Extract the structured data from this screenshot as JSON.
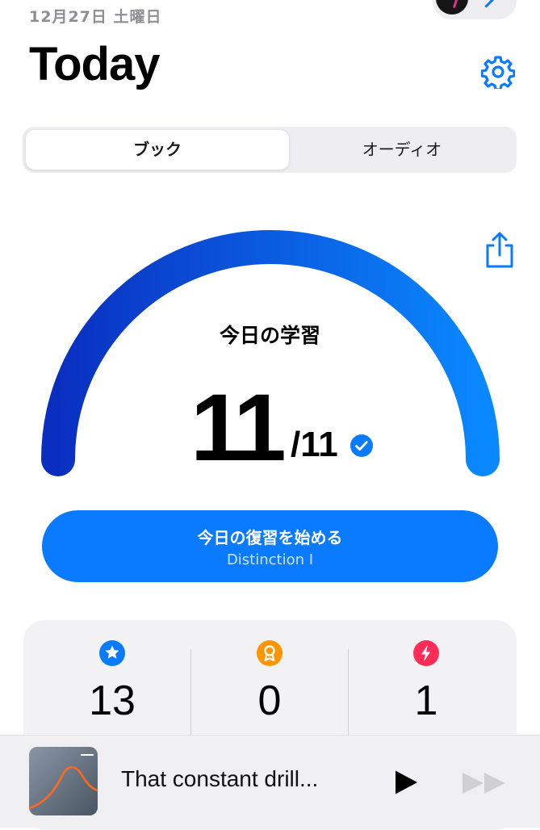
{
  "header": {
    "date": "12月27日 土曜日",
    "title": "Today"
  },
  "segments": {
    "book": "ブック",
    "audio": "オーディオ"
  },
  "progress": {
    "label": "今日の学習",
    "done": "11",
    "total": "/11",
    "fraction": 1.0,
    "complete": true
  },
  "cta": {
    "title": "今日の復習を始める",
    "subtitle": "Distinction I"
  },
  "stats": [
    {
      "icon": "star-icon",
      "value": "13",
      "color": "#0a7aff"
    },
    {
      "icon": "award-icon",
      "value": "0",
      "color": "#ff9500"
    },
    {
      "icon": "bolt-icon",
      "value": "1",
      "color": "#ff2d55"
    }
  ],
  "player": {
    "track": "That constant drill..."
  },
  "colors": {
    "accent": "#0a7aff",
    "gauge_start": "#0a2fc0",
    "gauge_end": "#0a88ff"
  }
}
